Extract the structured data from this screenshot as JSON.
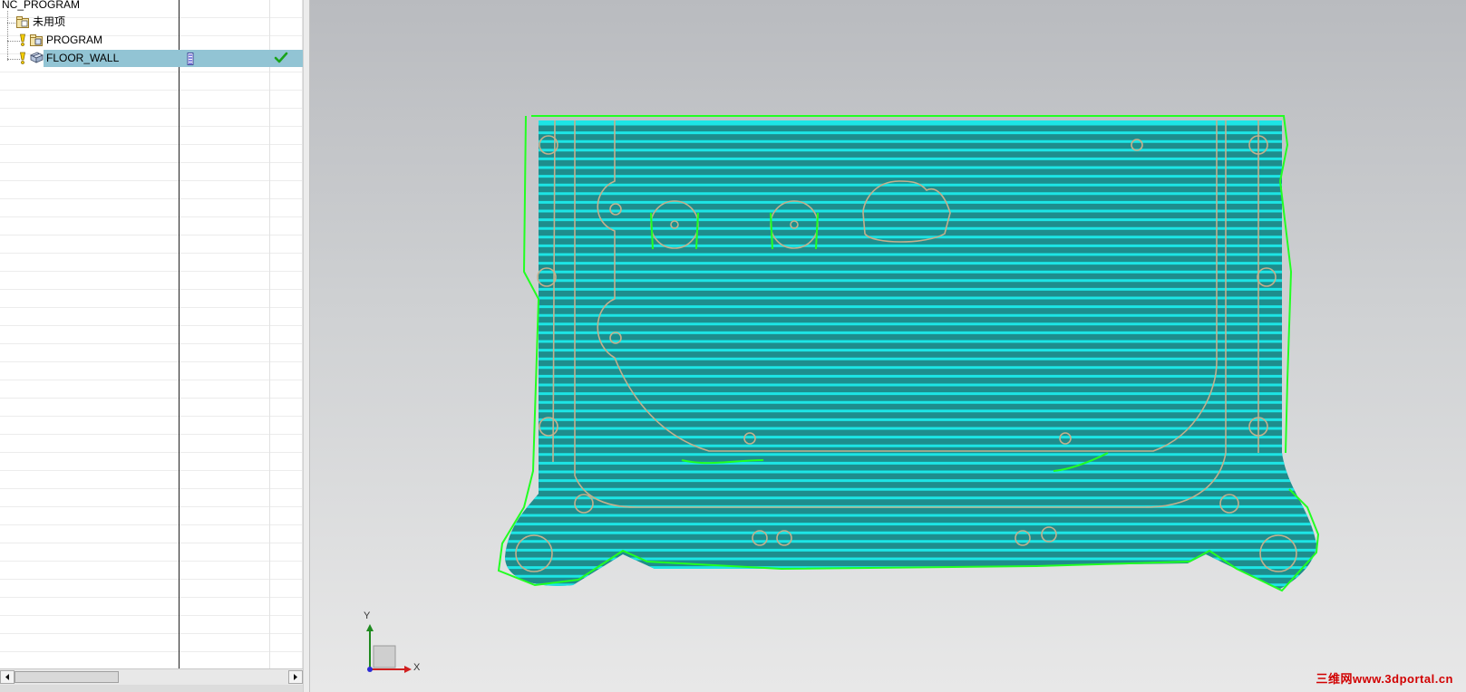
{
  "navigator": {
    "root_label": "NC_PROGRAM",
    "items": [
      {
        "label": "未用项",
        "icon": "folder-icon",
        "selected": false
      },
      {
        "label": "PROGRAM",
        "icon": "program-folder-icon",
        "status": "warning-icon",
        "selected": false
      },
      {
        "label": "FLOOR_WALL",
        "icon": "operation-icon",
        "status": "warning-icon",
        "path_icon": "toolpath-icon",
        "check": "checkmark-icon",
        "selected": true
      }
    ]
  },
  "graphics": {
    "toolpath_color": "#1de5e5",
    "boundary_color": "#22ff22",
    "floor_color": "#1e8d8d",
    "edge_color": "#c4b08c",
    "triad": {
      "x_label": "X",
      "y_label": "Y"
    }
  },
  "watermark": "三维网www.3dportal.cn"
}
